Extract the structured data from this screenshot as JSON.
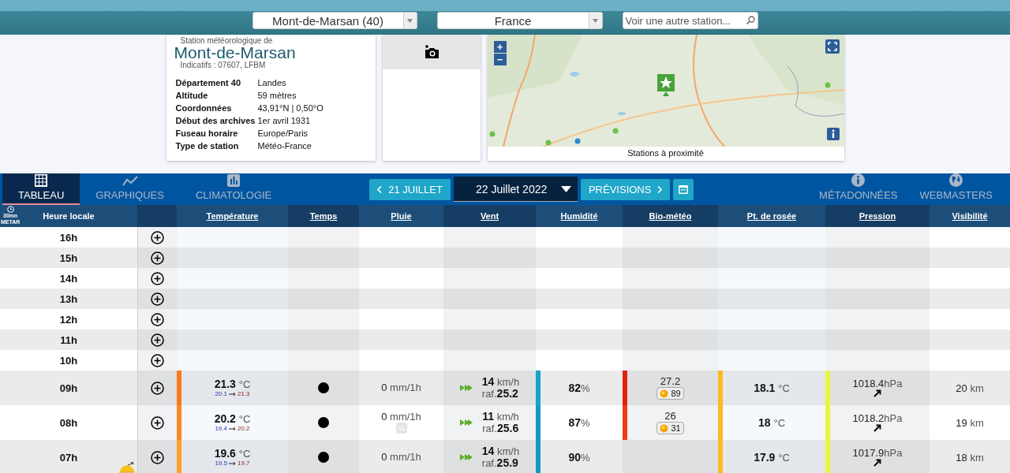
{
  "top_bar": {
    "city_select": "Mont-de-Marsan (40)",
    "country_select": "France",
    "search": {
      "placeholder": "Voir une autre station..."
    }
  },
  "station": {
    "caption": "Station météorologique de",
    "name": "Mont-de-Marsan",
    "codes": "Indicatifs : 07607, LFBM",
    "details": [
      {
        "label": "Département 40",
        "value": "Landes"
      },
      {
        "label": "Altitude",
        "value": "59 mètres"
      },
      {
        "label": "Coordonnées",
        "value": "43,91°N | 0,50°O"
      },
      {
        "label": "Début des archives",
        "value": "1er avril 1931"
      },
      {
        "label": "Fuseau horaire",
        "value": "Europe/Paris"
      },
      {
        "label": "Type de station",
        "value": "Météo-France"
      }
    ]
  },
  "map": {
    "kind": "picture",
    "zoom_in": "+",
    "zoom_out": "−",
    "caption": "Stations à proximité"
  },
  "tabs": [
    {
      "label": "TABLEAU",
      "selected": true
    },
    {
      "label": "GRAPHIQUES",
      "selected": false
    },
    {
      "label": "CLIMATOLOGIE",
      "selected": false
    }
  ],
  "date_nav": {
    "previous": "21 JUILLET",
    "date": "22 Juillet 2022",
    "next": "PRÉVISIONS"
  },
  "links": [
    {
      "label": "MÉTADONNÉES"
    },
    {
      "label": "WEBMASTERS"
    }
  ],
  "table": {
    "time_header": {
      "interval": "30mn",
      "source": "METAR",
      "label": "Heure locale"
    },
    "columns": [
      "Température",
      "Temps",
      "Pluie",
      "Vent",
      "Humidité",
      "Bio-météo",
      "Pt. de rosée",
      "Pression",
      "Visibilité"
    ],
    "rows": [
      {
        "time": "16h"
      },
      {
        "time": "15h"
      },
      {
        "time": "14h"
      },
      {
        "time": "13h"
      },
      {
        "time": "12h"
      },
      {
        "time": "11h"
      },
      {
        "time": "10h"
      },
      {
        "time": "09h",
        "sunrise": false,
        "temperature": {
          "value": "21.3",
          "unit": "°C",
          "min": "20.1",
          "max": "21.3",
          "color": "#f47920"
        },
        "weather": {
          "kind": "dot"
        },
        "rain": {
          "value": "0",
          "unit": "mm/1h",
          "drizzle": false
        },
        "wind": {
          "speed": "14",
          "unit": "km/h",
          "gust_label": "raf.",
          "gust": "25.2"
        },
        "humidity": {
          "value": "82",
          "unit": "%",
          "color": "#1aa3c9"
        },
        "bio": {
          "value": "27.2",
          "index": "89",
          "color": "#e2230e"
        },
        "dew_point": {
          "value": "18.1",
          "unit": "°C",
          "color": "#fbbb22"
        },
        "pressure": {
          "value": "1018.4",
          "unit": "hPa",
          "color": "#e8f53c"
        },
        "visibility": {
          "value": "20",
          "unit": "km"
        }
      },
      {
        "time": "08h",
        "sunrise": false,
        "temperature": {
          "value": "20.2",
          "unit": "°C",
          "min": "19.4",
          "max": "20.2",
          "color": "#f7892a"
        },
        "weather": {
          "kind": "dot"
        },
        "rain": {
          "value": "0",
          "unit": "mm/1h",
          "drizzle": true
        },
        "wind": {
          "speed": "11",
          "unit": "km/h",
          "gust_label": "raf.",
          "gust": "25.6"
        },
        "humidity": {
          "value": "87",
          "unit": "%",
          "color": "#1597c8"
        },
        "bio": {
          "value": "26",
          "index": "31",
          "color": "#ef3c12"
        },
        "dew_point": {
          "value": "18",
          "unit": "°C",
          "color": "#fbbb22"
        },
        "pressure": {
          "value": "1018.2",
          "unit": "hPa",
          "color": "#e8f53c"
        },
        "visibility": {
          "value": "19",
          "unit": "km"
        }
      },
      {
        "time": "07h",
        "sunrise": true,
        "temperature": {
          "value": "19.6",
          "unit": "°C",
          "min": "19.5",
          "max": "19.7",
          "color": "#f9a02e"
        },
        "weather": {
          "kind": "dot"
        },
        "rain": {
          "value": "0",
          "unit": "mm/1h",
          "drizzle": false
        },
        "wind": {
          "speed": "14",
          "unit": "km/h",
          "gust_label": "raf.",
          "gust": "25.9"
        },
        "humidity": {
          "value": "90",
          "unit": "%",
          "color": "#1597c8"
        },
        "dew_point": {
          "value": "17.9",
          "unit": "°C",
          "color": "#fbbb22"
        },
        "pressure": {
          "value": "1017.9",
          "unit": "hPa",
          "color": "#e8f53c"
        },
        "visibility": {
          "value": "18",
          "unit": "km"
        }
      }
    ]
  }
}
